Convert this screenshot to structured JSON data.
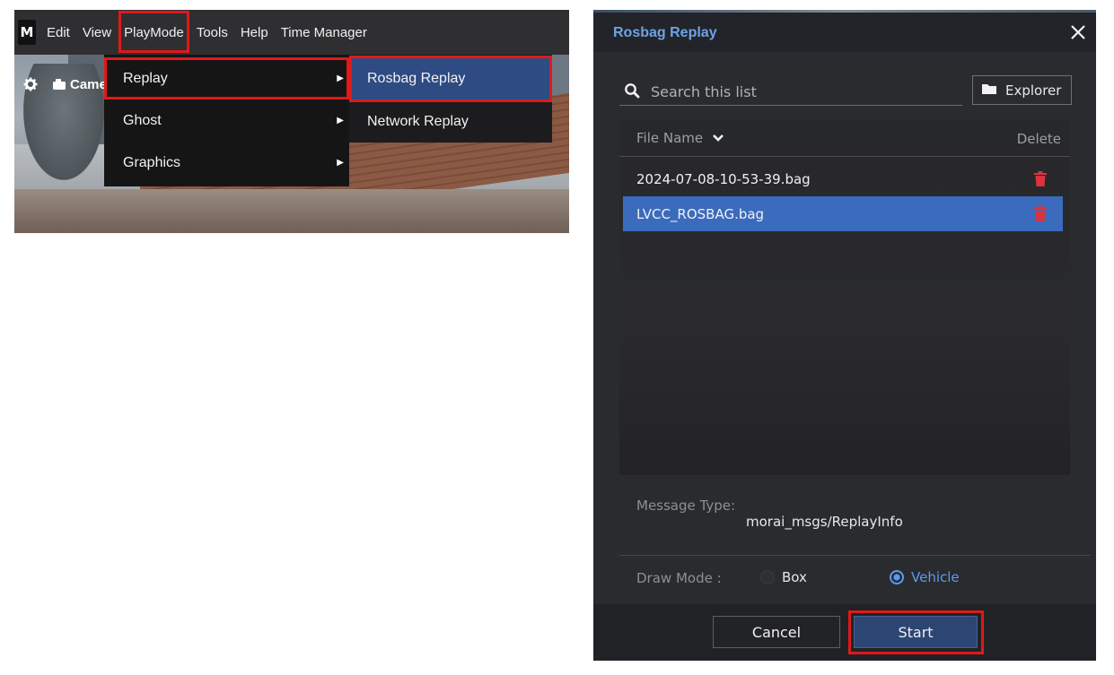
{
  "app": {
    "logo": "M",
    "menu": [
      "Edit",
      "View",
      "PlayMode",
      "Tools",
      "Help",
      "Time Manager"
    ],
    "toolbar_label": "Camer",
    "playmode_menu": [
      {
        "label": "Replay"
      },
      {
        "label": "Ghost"
      },
      {
        "label": "Graphics"
      }
    ],
    "replay_submenu": [
      {
        "label": "Rosbag Replay"
      },
      {
        "label": "Network Replay"
      }
    ]
  },
  "dialog": {
    "title": "Rosbag Replay",
    "search_placeholder": "Search this list",
    "explorer_label": "Explorer",
    "col_file": "File Name",
    "col_delete": "Delete",
    "files": [
      {
        "name": "2024-07-08-10-53-39.bag",
        "selected": false
      },
      {
        "name": "LVCC_ROSBAG.bag",
        "selected": true
      }
    ],
    "message_type_label": "Message Type:",
    "message_type_value": "morai_msgs/ReplayInfo",
    "draw_mode_label": "Draw Mode :",
    "draw_mode_options": [
      "Box",
      "Vehicle"
    ],
    "draw_mode_selected": "Vehicle",
    "cancel_label": "Cancel",
    "start_label": "Start"
  },
  "colors": {
    "accent_blue": "#5b9cf0",
    "selected_row": "#3a6bbd",
    "highlight_red": "#e01919",
    "trash_red": "#d9343d"
  },
  "icons": [
    "gear-icon",
    "camera-icon",
    "chevron-right-icon",
    "search-icon",
    "folder-icon",
    "chevron-down-icon",
    "trash-icon",
    "close-icon"
  ]
}
